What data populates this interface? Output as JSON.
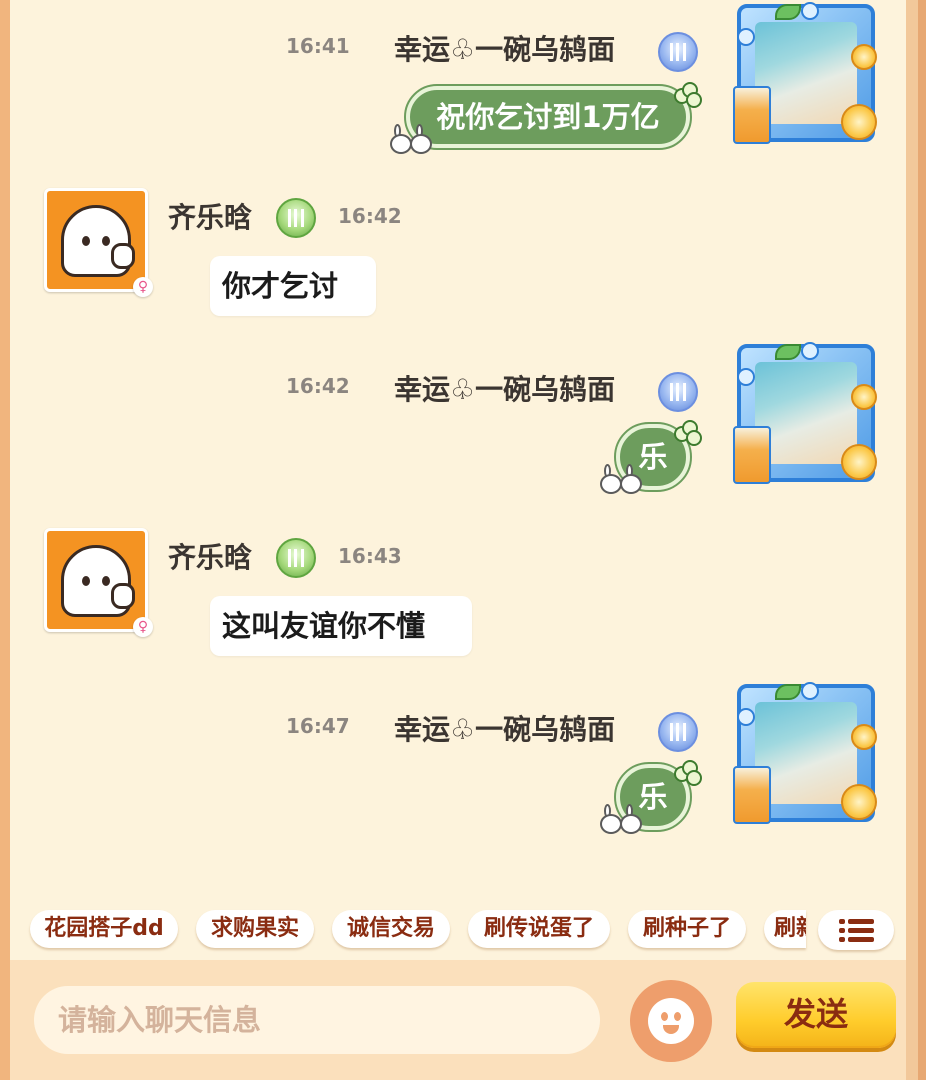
{
  "messages": [
    {
      "side": "right",
      "time": "16:41",
      "name": "幸运♧一碗乌鸫面",
      "text": "祝你乞讨到1万亿"
    },
    {
      "side": "left",
      "time": "16:42",
      "name": "齐乐晗",
      "gender": "♀",
      "text": "你才乞讨"
    },
    {
      "side": "right",
      "time": "16:42",
      "name": "幸运♧一碗乌鸫面",
      "text": "乐"
    },
    {
      "side": "left",
      "time": "16:43",
      "name": "齐乐晗",
      "gender": "♀",
      "text": "这叫友谊你不懂"
    },
    {
      "side": "right",
      "time": "16:47",
      "name": "幸运♧一碗乌鸫面",
      "text": "乐"
    }
  ],
  "quick_phrases": [
    "花园搭子dd",
    "求购果实",
    "诚信交易",
    "刷传说蛋了",
    "刷种子了",
    "刷新"
  ],
  "input": {
    "placeholder": "请输入聊天信息",
    "value": ""
  },
  "send_label": "发送",
  "icons": {
    "badge_right": "crown-badge-icon",
    "badge_left": "level-badge-icon",
    "menu": "list-menu-icon",
    "emoji": "smiley-face-icon"
  },
  "colors": {
    "panel_bg": "#fdf3dc",
    "green_bubble": "#6d9d5d",
    "chip_text": "#8a2c11",
    "send_button": "#ffcc2b"
  }
}
